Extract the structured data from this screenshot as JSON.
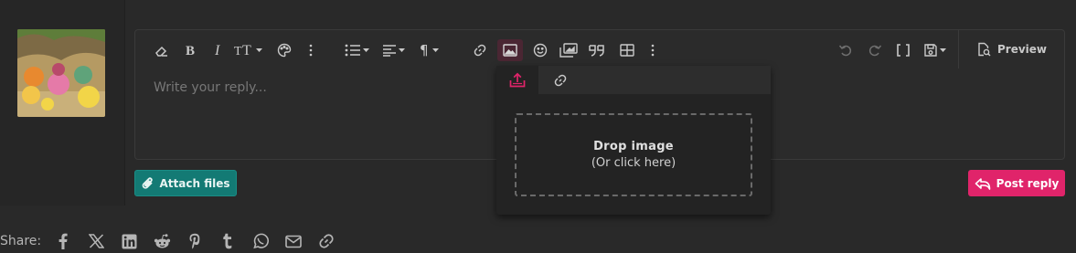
{
  "editor": {
    "placeholder": "Write your reply...",
    "preview_label": "Preview",
    "toolbar_icons": [
      "eraser-icon",
      "bold-icon",
      "italic-icon",
      "text-size-icon",
      "palette-icon",
      "more-vertical-icon",
      "list-icon",
      "align-icon",
      "paragraph-icon",
      "link-icon",
      "image-icon",
      "smiley-icon",
      "media-icon",
      "quote-icon",
      "table-icon",
      "more-vertical-icon",
      "undo-icon",
      "redo-icon",
      "brackets-icon",
      "save-icon"
    ]
  },
  "image_popup": {
    "tabs": [
      "upload-icon",
      "link-icon"
    ],
    "drop_title": "Drop image",
    "drop_subtitle": "(Or click here)"
  },
  "actions": {
    "attach_label": "Attach files",
    "post_label": "Post reply"
  },
  "share": {
    "label": "Share:",
    "icons": [
      "facebook-icon",
      "x-icon",
      "linkedin-icon",
      "reddit-icon",
      "pinterest-icon",
      "tumblr-icon",
      "whatsapp-icon",
      "email-icon",
      "link-icon"
    ]
  },
  "colors": {
    "background": "#292929",
    "accent_pink": "#e0246a",
    "accent_teal": "#137a74",
    "active_tool_bg": "#4a2633"
  }
}
